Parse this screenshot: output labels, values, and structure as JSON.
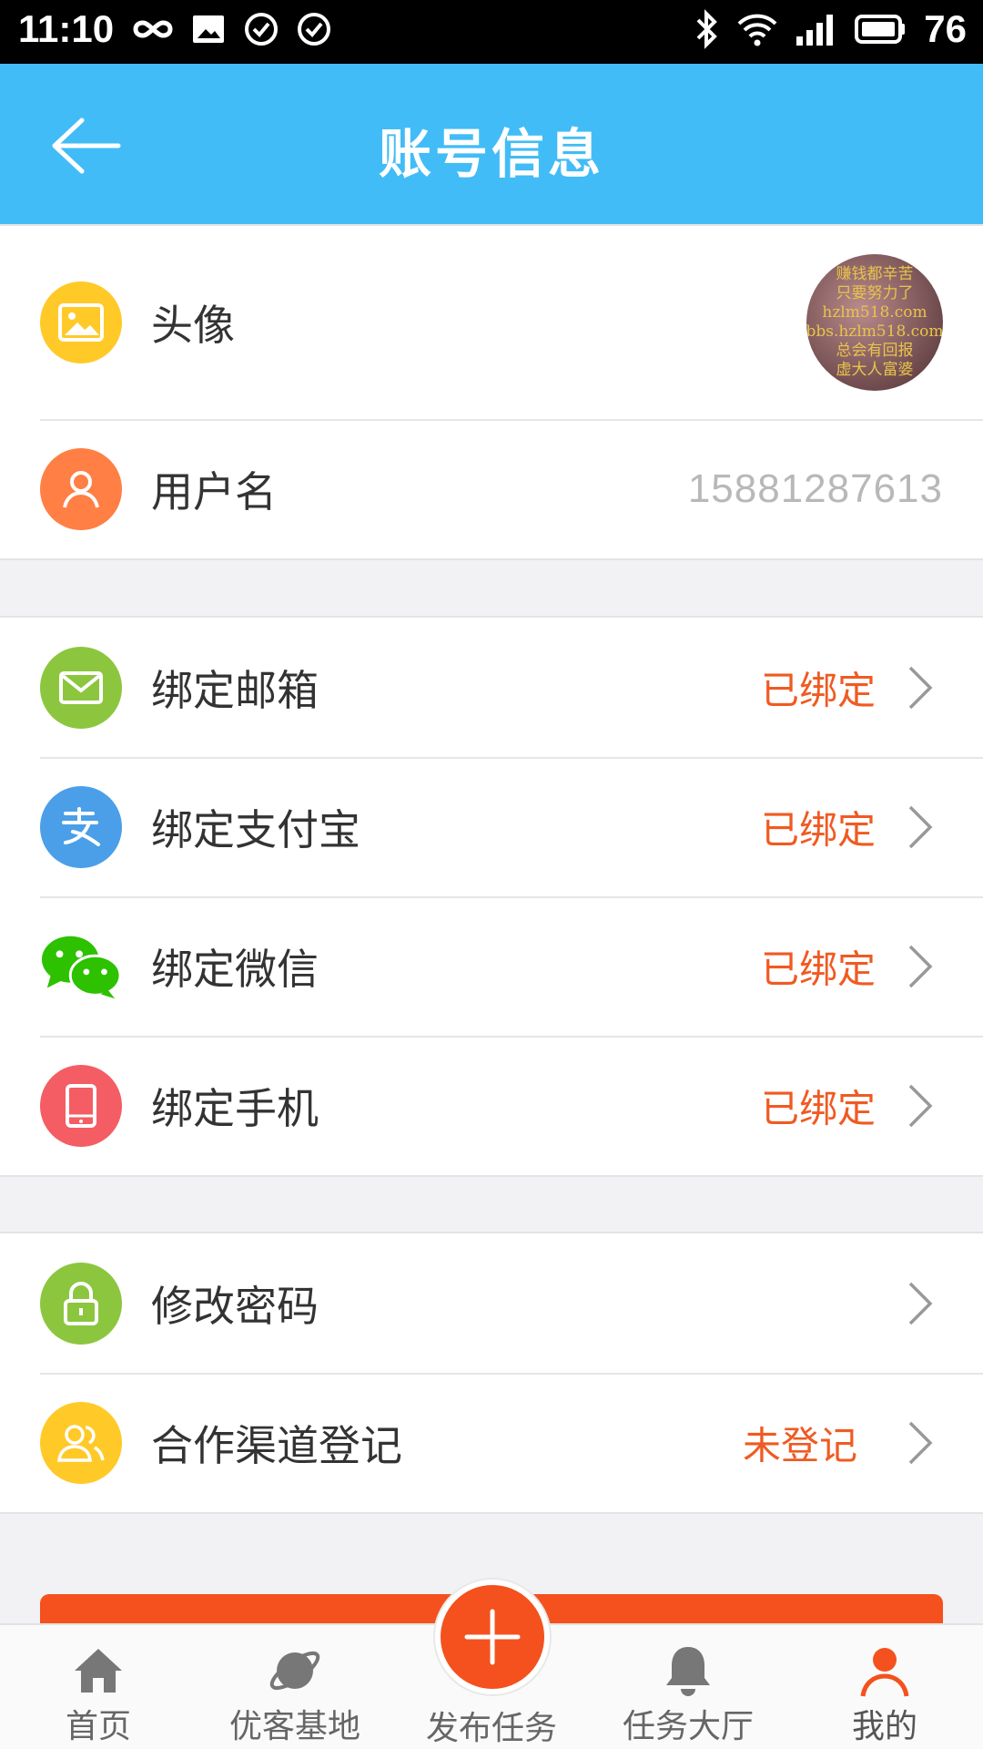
{
  "status_bar": {
    "time": "11:10",
    "battery": "76"
  },
  "app_bar": {
    "title": "账号信息"
  },
  "profile": {
    "avatar_label": "头像",
    "avatar_text": [
      "赚钱都辛苦",
      "只要努力了",
      "hzlm518.com",
      "bbs.hzlm518.com",
      "总会有回报",
      "虚大人富婆"
    ],
    "username_label": "用户名",
    "username_value": "15881287613"
  },
  "bindings": [
    {
      "label": "绑定邮箱",
      "status": "已绑定",
      "icon": "mail-icon",
      "color": "#8cc63f"
    },
    {
      "label": "绑定支付宝",
      "status": "已绑定",
      "icon": "alipay-icon",
      "color": "#4a9fe8"
    },
    {
      "label": "绑定微信",
      "status": "已绑定",
      "icon": "wechat-icon",
      "color": "#2dc100"
    },
    {
      "label": "绑定手机",
      "status": "已绑定",
      "icon": "phone-icon",
      "color": "#f45d64"
    }
  ],
  "security": [
    {
      "label": "修改密码",
      "status": "",
      "icon": "lock-icon",
      "color": "#8cc63f"
    },
    {
      "label": "合作渠道登记",
      "status": "未登记",
      "icon": "users-icon",
      "color": "#ffc928"
    }
  ],
  "tabs": [
    {
      "label": "首页",
      "icon": "home-icon"
    },
    {
      "label": "优客基地",
      "icon": "planet-icon"
    },
    {
      "label": "发布任务",
      "icon": "plus-icon"
    },
    {
      "label": "任务大厅",
      "icon": "bell-icon"
    },
    {
      "label": "我的",
      "icon": "person-icon"
    }
  ],
  "colors": {
    "accent": "#42bcf6",
    "status": "#f05a22",
    "primary_button": "#f4511e"
  }
}
